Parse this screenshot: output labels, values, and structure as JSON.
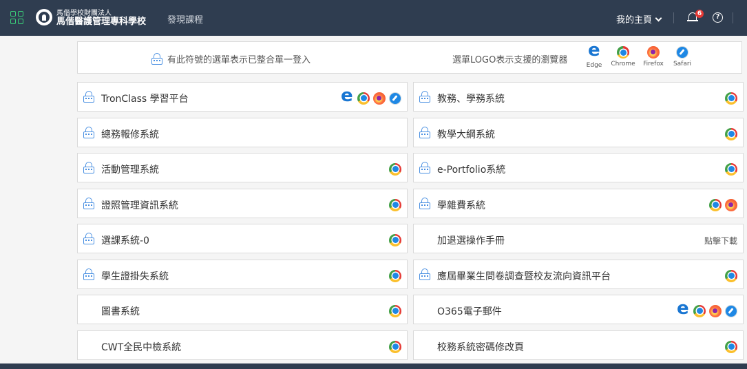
{
  "header": {
    "org_small": "馬偕學校財團法人",
    "org_name": "馬偕醫護管理專科學校",
    "discover": "發現課程",
    "my_home": "我的主頁",
    "notifications": "6"
  },
  "info": {
    "sso_text": "有此符號的選單表示已整合單一登入",
    "logo_text": "選單LOGO表示支援的瀏覽器",
    "browsers": [
      "Edge",
      "Chrome",
      "Firefox",
      "Safari"
    ]
  },
  "systems_left": [
    {
      "label": "TronClass 學習平台",
      "sso": true,
      "browsers": [
        "edge",
        "chrome",
        "firefox",
        "safari"
      ]
    },
    {
      "label": "總務報修系統",
      "sso": true,
      "browsers": []
    },
    {
      "label": "活動管理系統",
      "sso": true,
      "browsers": [
        "chrome"
      ]
    },
    {
      "label": "證照管理資訊系統",
      "sso": true,
      "browsers": [
        "chrome"
      ]
    },
    {
      "label": "選課系統-0",
      "sso": true,
      "browsers": [
        "chrome"
      ]
    },
    {
      "label": "學生證掛失系統",
      "sso": true,
      "browsers": [
        "chrome"
      ]
    },
    {
      "label": "圖書系統",
      "sso": false,
      "browsers": [
        "chrome"
      ]
    },
    {
      "label": "CWT全民中檢系統",
      "sso": false,
      "browsers": [
        "chrome"
      ]
    }
  ],
  "systems_right": [
    {
      "label": "教務、學務系統",
      "sso": true,
      "browsers": [
        "chrome"
      ]
    },
    {
      "label": "教學大綱系統",
      "sso": true,
      "browsers": [
        "chrome"
      ]
    },
    {
      "label": "e-Portfolio系統",
      "sso": true,
      "browsers": [
        "chrome"
      ]
    },
    {
      "label": "學雜費系統",
      "sso": true,
      "browsers": [
        "chrome",
        "firefox"
      ]
    },
    {
      "label": "加退選操作手冊",
      "sso": false,
      "browsers": [],
      "download": "點擊下載"
    },
    {
      "label": "應屆畢業生問卷調查暨校友流向資訊平台",
      "sso": true,
      "browsers": [
        "chrome"
      ]
    },
    {
      "label": "O365電子郵件",
      "sso": false,
      "browsers": [
        "edge",
        "chrome",
        "firefox",
        "safari"
      ]
    },
    {
      "label": "校務系統密碼修改頁",
      "sso": false,
      "browsers": [
        "chrome"
      ]
    }
  ],
  "colors": {
    "topbar": "#2f3d50",
    "sso_icon": "#4a90e2",
    "badge": "#e53935",
    "apps_icon": "#3ad07a"
  },
  "icons": {
    "apps": "apps-grid-icon",
    "bell": "bell-icon",
    "help": "help-icon",
    "sso": "sso-lock-icon"
  }
}
